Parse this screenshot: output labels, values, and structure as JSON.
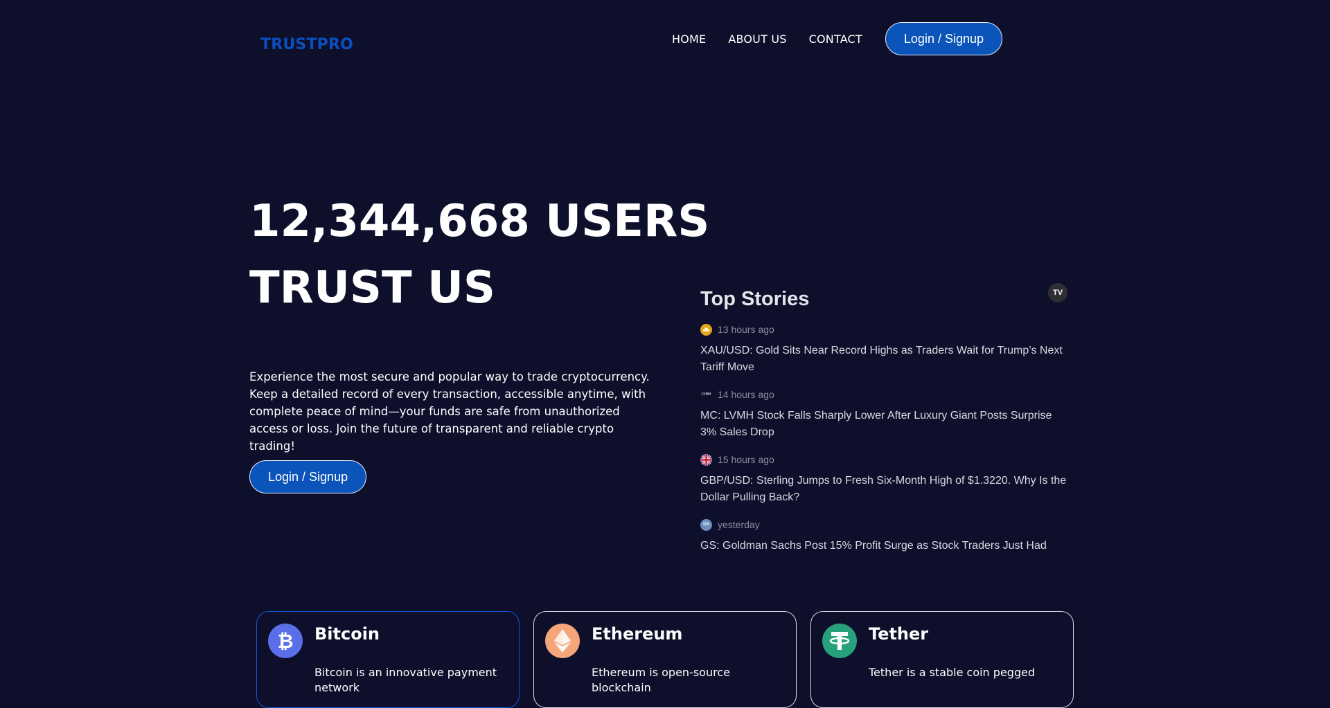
{
  "header": {
    "brand": "TRUSTPRO",
    "nav": [
      "HOME",
      "ABOUT US",
      "CONTACT"
    ],
    "login_label": "Login / Signup"
  },
  "hero": {
    "title_line1": "12,344,668 USERS",
    "title_line2": "TRUST US",
    "description": "Experience the most secure and popular way to trade cryptocurrency. Keep a detailed record of every transaction, accessible anytime, with complete peace of mind—your funds are safe from unauthorized access or loss. Join the future of transparent and reliable crypto trading!",
    "cta_label": "Login / Signup"
  },
  "top_stories": {
    "title": "Top Stories",
    "logo_text": "TV",
    "items": [
      {
        "icon": "gold-coin-icon",
        "time": "13 hours ago",
        "headline": "XAU/USD: Gold Sits Near Record Highs as Traders Wait for Trump’s Next Tariff Move"
      },
      {
        "icon": "lvmh-logo-icon",
        "time": "14 hours ago",
        "headline": "MC: LVMH Stock Falls Sharply Lower After Luxury Giant Posts Surprise 3% Sales Drop"
      },
      {
        "icon": "uk-flag-icon",
        "time": "15 hours ago",
        "headline": "GBP/USD: Sterling Jumps to Fresh Six-Month High of $1.3220. Why Is the Dollar Pulling Back?"
      },
      {
        "icon": "goldman-sachs-icon",
        "time": "yesterday",
        "headline": "GS: Goldman Sachs Post 15% Profit Surge as Stock Traders Just Had"
      }
    ]
  },
  "coins": [
    {
      "name": "Bitcoin",
      "symbol": "₿",
      "icon": "bitcoin-icon",
      "color": "#5a6ee8",
      "description": "Bitcoin is an innovative payment network"
    },
    {
      "name": "Ethereum",
      "symbol": "◆",
      "icon": "ethereum-icon",
      "color": "#f4a57a",
      "description": "Ethereum is open-source blockchain"
    },
    {
      "name": "Tether",
      "symbol": "₮",
      "icon": "tether-icon",
      "color": "#26a17b",
      "description": "Tether is a stable coin pegged"
    }
  ],
  "colors": {
    "background": "#0e0f2b",
    "brand": "#0a4fbf",
    "button": "#0b54b9"
  }
}
